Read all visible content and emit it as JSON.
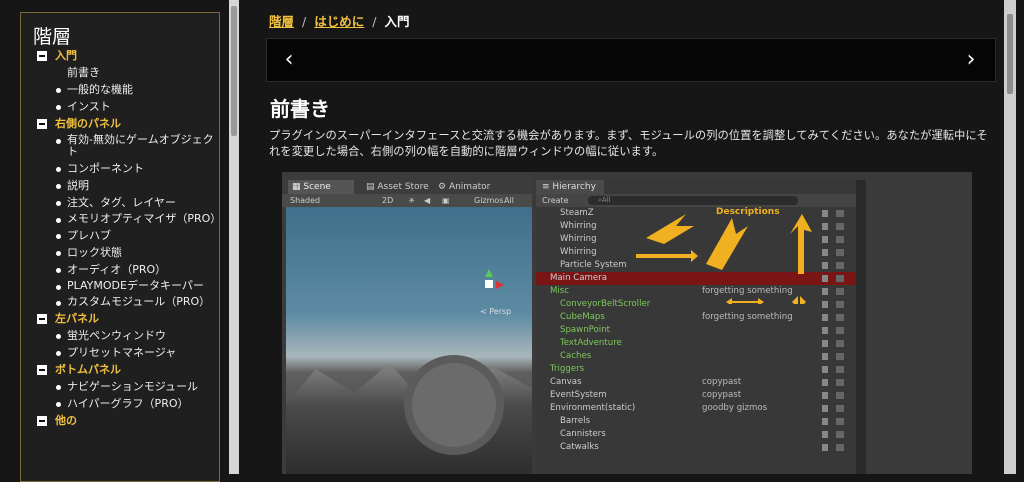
{
  "sidebar": {
    "title": "階層",
    "sections": [
      {
        "label": "入門",
        "items": [
          {
            "label": "前書き",
            "bullet": false
          },
          {
            "label": "一般的な機能",
            "bullet": true
          },
          {
            "label": "インスト",
            "bullet": true
          }
        ]
      },
      {
        "label": "右側のパネル",
        "items": [
          {
            "label": "有効-無効にゲームオブジェクト",
            "bullet": true
          },
          {
            "label": "コンポーネント",
            "bullet": true
          },
          {
            "label": "説明",
            "bullet": true
          },
          {
            "label": "注文、タグ、レイヤー",
            "bullet": true
          },
          {
            "label": "メモリオプティマイザ（PRO）",
            "bullet": true
          },
          {
            "label": "プレハブ",
            "bullet": true
          },
          {
            "label": "ロック状態",
            "bullet": true
          },
          {
            "label": "オーディオ（PRO）",
            "bullet": true
          },
          {
            "label": "PLAYMODEデータキーパー",
            "bullet": true
          },
          {
            "label": "カスタムモジュール（PRO）",
            "bullet": true
          }
        ]
      },
      {
        "label": "左パネル",
        "items": [
          {
            "label": "蛍光ペンウィンドウ",
            "bullet": true
          },
          {
            "label": "プリセットマネージャ",
            "bullet": true
          }
        ]
      },
      {
        "label": "ボトムパネル",
        "items": [
          {
            "label": "ナビゲーションモジュール",
            "bullet": true
          },
          {
            "label": "ハイパーグラフ（PRO）",
            "bullet": true
          }
        ]
      },
      {
        "label": "他の",
        "items": []
      }
    ]
  },
  "breadcrumb": {
    "home": "階層",
    "parent": "はじめに",
    "current": "入門",
    "sep": "/"
  },
  "pager": {
    "prev": "‹",
    "next": "›"
  },
  "page": {
    "title": "前書き",
    "paragraph": "プラグインのスーパーインタフェースと交流する機会があります。まず、モジュールの列の位置を調整してみてください。あなたが運転中にそれを変更した場合、右側の列の幅を自動的に階層ウィンドウの幅に従います。"
  },
  "screenshot": {
    "scene_tab": "Scene",
    "asset_store_tab": "Asset Store",
    "animator_tab": "Animator",
    "shading": "Shaded",
    "mode_2d": "2D",
    "gizmos": "Gizmos",
    "search_all": "All",
    "persp": "Persp",
    "hierarchy_tab": "Hierarchy",
    "create": "Create",
    "descriptions_annotation": "Descriptions",
    "rows": [
      {
        "name": "SteamZ",
        "desc": "",
        "indent": 2,
        "sel": false,
        "green": false
      },
      {
        "name": "Whirring",
        "desc": "",
        "indent": 2,
        "sel": false,
        "green": false
      },
      {
        "name": "Whirring",
        "desc": "",
        "indent": 2,
        "sel": false,
        "green": false
      },
      {
        "name": "Whirring",
        "desc": "",
        "indent": 2,
        "sel": false,
        "green": false
      },
      {
        "name": "Particle System",
        "desc": "",
        "indent": 2,
        "sel": false,
        "green": false
      },
      {
        "name": "Main Camera",
        "desc": "",
        "indent": 1,
        "sel": true,
        "green": false
      },
      {
        "name": "Misc",
        "desc": "forgetting something",
        "indent": 1,
        "sel": false,
        "green": true
      },
      {
        "name": "ConveyorBeltScroller",
        "desc": "",
        "indent": 2,
        "sel": false,
        "green": true
      },
      {
        "name": "CubeMaps",
        "desc": "forgetting something",
        "indent": 2,
        "sel": false,
        "green": true
      },
      {
        "name": "SpawnPoint",
        "desc": "",
        "indent": 2,
        "sel": false,
        "green": true
      },
      {
        "name": "TextAdventure",
        "desc": "",
        "indent": 2,
        "sel": false,
        "green": true
      },
      {
        "name": "Caches",
        "desc": "",
        "indent": 2,
        "sel": false,
        "green": true
      },
      {
        "name": "Triggers",
        "desc": "",
        "indent": 1,
        "sel": false,
        "green": true
      },
      {
        "name": "Canvas",
        "desc": "copypast",
        "indent": 1,
        "sel": false,
        "green": false
      },
      {
        "name": "EventSystem",
        "desc": "copypast",
        "indent": 1,
        "sel": false,
        "green": false
      },
      {
        "name": "Environment(static)",
        "desc": "goodby gizmos",
        "indent": 1,
        "sel": false,
        "green": false
      },
      {
        "name": "Barrels",
        "desc": "",
        "indent": 2,
        "sel": false,
        "green": false
      },
      {
        "name": "Cannisters",
        "desc": "",
        "indent": 2,
        "sel": false,
        "green": false
      },
      {
        "name": "Catwalks",
        "desc": "",
        "indent": 2,
        "sel": false,
        "green": false
      }
    ]
  }
}
